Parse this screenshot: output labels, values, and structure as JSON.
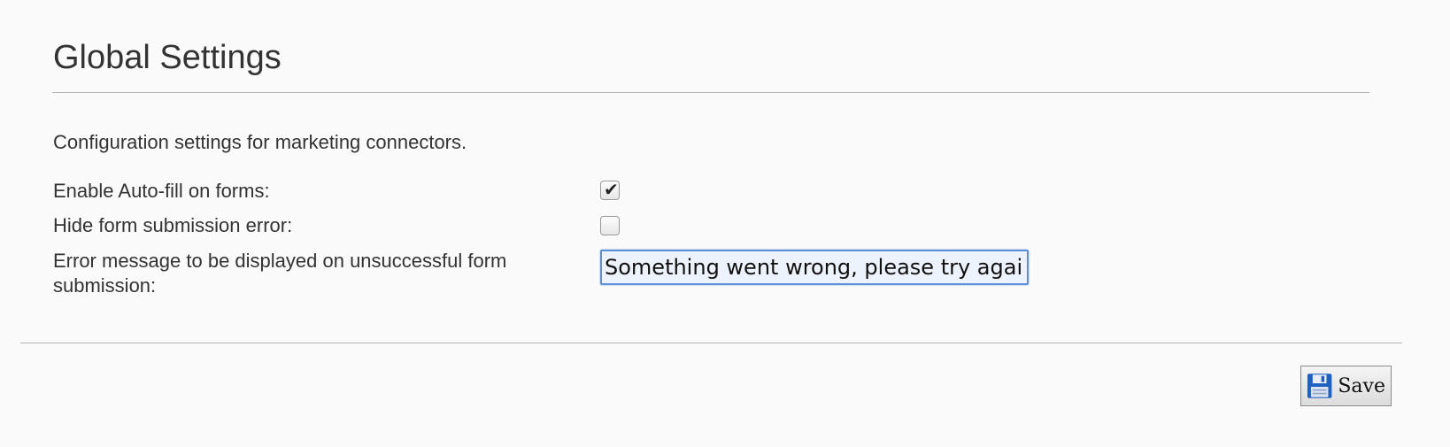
{
  "page": {
    "title": "Global Settings",
    "description": "Configuration settings for marketing connectors."
  },
  "settings": {
    "autofill": {
      "label": "Enable Auto-fill on forms:",
      "checked": true
    },
    "hide_error": {
      "label": "Hide form submission error:",
      "checked": false
    },
    "error_message": {
      "label": "Error message to be displayed on unsuccessful form submission:",
      "value": "Something went wrong, please try again."
    }
  },
  "footer": {
    "save_label": "Save",
    "save_icon": "floppy-disk-icon"
  },
  "colors": {
    "input_focus_border": "#5b8fd8",
    "floppy_blue": "#1f5fbf"
  }
}
